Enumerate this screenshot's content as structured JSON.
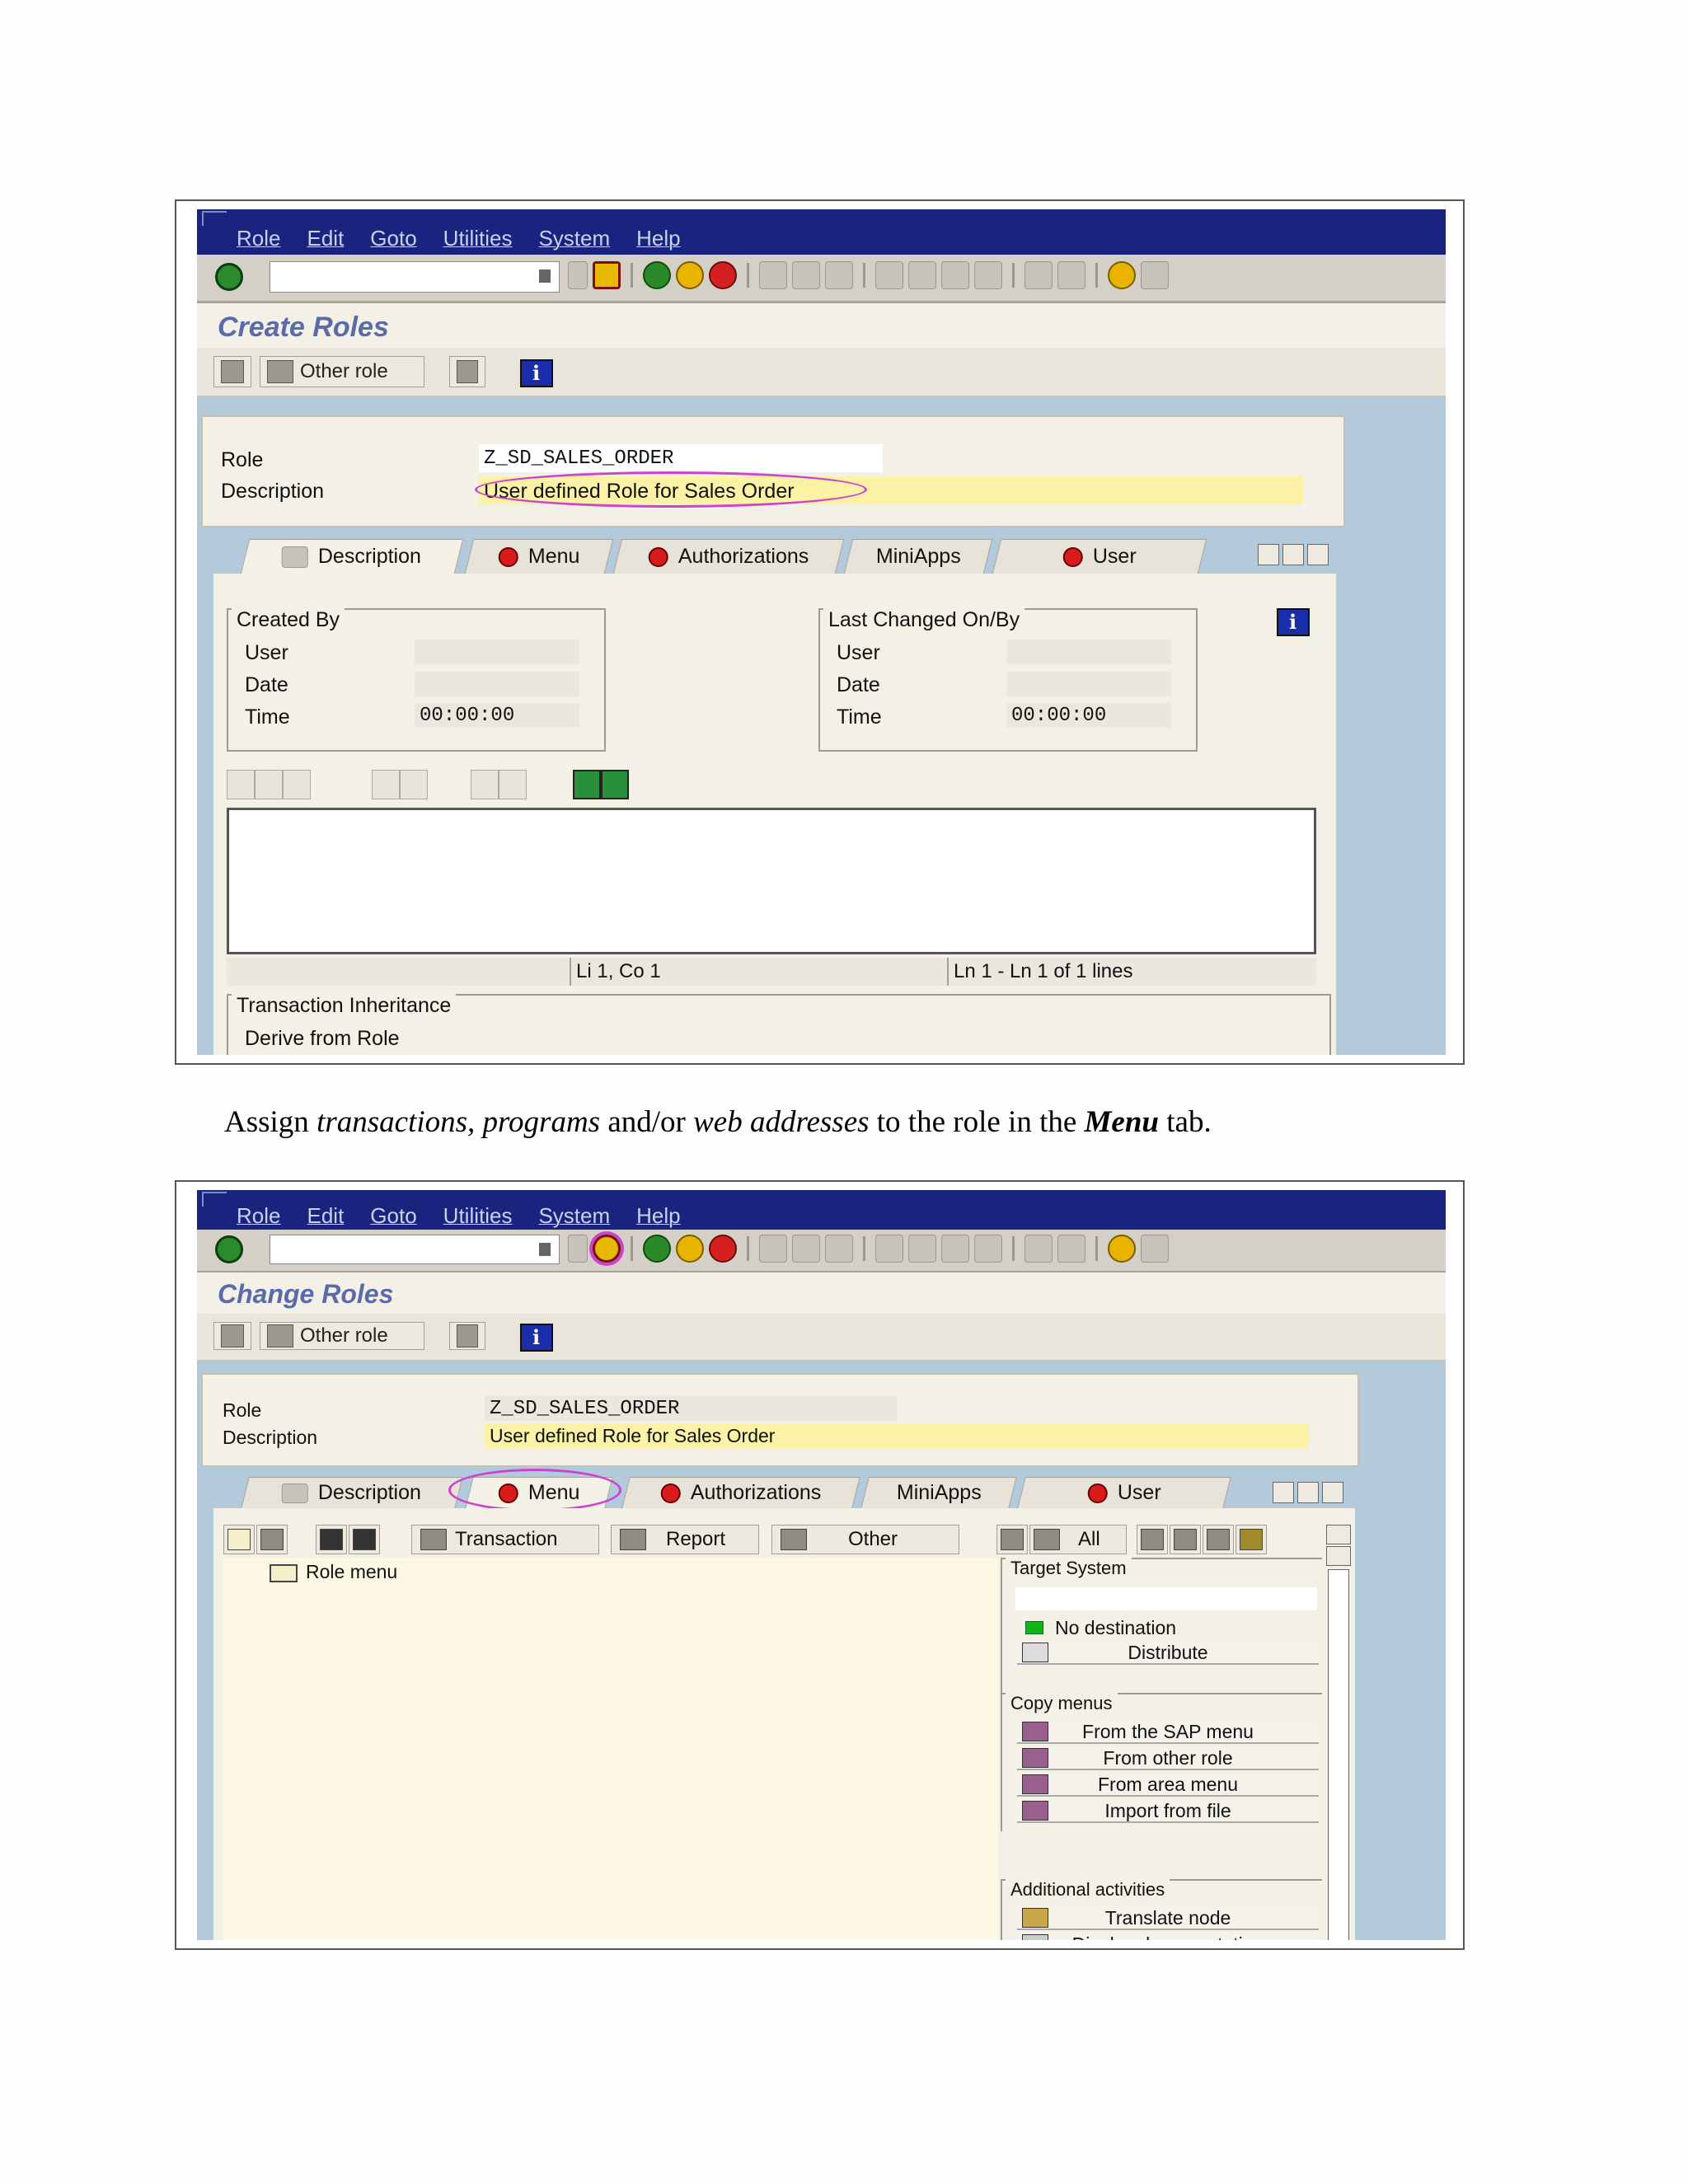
{
  "menu": [
    "Role",
    "Edit",
    "Goto",
    "Utilities",
    "System",
    "Help"
  ],
  "screen1": {
    "title": "Create Roles",
    "other_role": "Other role",
    "role_label": "Role",
    "role_value": "Z_SD_SALES_ORDER",
    "desc_label": "Description",
    "desc_value": "User defined Role for Sales Order",
    "tabs": [
      "Description",
      "Menu",
      "Authorizations",
      "MiniApps",
      "User"
    ],
    "created_by": {
      "title": "Created By",
      "user": "User",
      "date": "Date",
      "time": "Time",
      "time_value": "00:00:00"
    },
    "last_changed": {
      "title": "Last Changed On/By",
      "user": "User",
      "date": "Date",
      "time": "Time",
      "time_value": "00:00:00"
    },
    "status_pos": "Li 1, Co 1",
    "status_lines": "Ln 1 - Ln 1 of 1 lines",
    "inherit_title": "Transaction Inheritance",
    "derive_label": "Derive from Role"
  },
  "caption": {
    "p1": "Assign ",
    "p2": "transactions, programs",
    "p3": " and/or ",
    "p4": "web addresses",
    "p5": " to the role in the ",
    "p6": "Menu",
    "p7": " tab."
  },
  "screen2": {
    "title": "Change Roles",
    "other_role": "Other role",
    "role_label": "Role",
    "role_value": "Z_SD_SALES_ORDER",
    "desc_label": "Description",
    "desc_value": "User defined Role for Sales Order",
    "tabs": [
      "Description",
      "Menu",
      "Authorizations",
      "MiniApps",
      "User"
    ],
    "menu_toolbar": {
      "transaction": "Transaction",
      "report": "Report",
      "other": "Other",
      "all": "All"
    },
    "tree_root": "Role menu",
    "target_system": {
      "title": "Target System",
      "status": "No destination",
      "distribute": "Distribute"
    },
    "copy_menus": {
      "title": "Copy menus",
      "items": [
        "From the SAP menu",
        "From other role",
        "From area menu",
        "Import from file"
      ]
    },
    "additional": {
      "title": "Additional activities",
      "items": [
        "Translate node",
        "Display documentation"
      ]
    }
  },
  "colors": {
    "menubar": "#1a237e",
    "background": "#b3c9dc",
    "highlight": "#cc44cc",
    "field_yellow": "#fbf2a6"
  }
}
